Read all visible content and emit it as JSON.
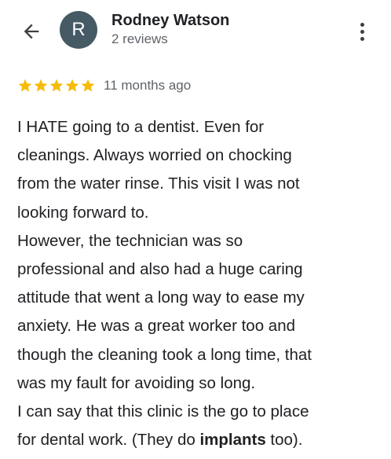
{
  "reviewer": {
    "avatar_initial": "R",
    "avatar_color": "#455a64",
    "name": "Rodney Watson",
    "reviews_count": "2 reviews"
  },
  "rating": {
    "stars": 5,
    "max_stars": 5,
    "star_color": "#f6bb06",
    "time": "11 months ago"
  },
  "icons": {
    "back": "arrow-left-icon",
    "more": "more-vertical-icon",
    "star": "star-icon"
  },
  "review": {
    "lines": [
      "I HATE going to a dentist. Even for",
      "cleanings. Always worried on chocking",
      "from the water rinse. This visit I was not",
      "looking forward to.",
      "However, the technician was so",
      "professional and also had a huge caring",
      "attitude that went a long way to ease my",
      "anxiety. He was a great worker too and",
      "though the cleaning took a long time, that",
      "was my fault for avoiding so long.",
      "I can say that this clinic is the go to place"
    ],
    "last_line": {
      "before": "for dental work. (They do ",
      "bold": "implants",
      "after": " too)."
    }
  }
}
